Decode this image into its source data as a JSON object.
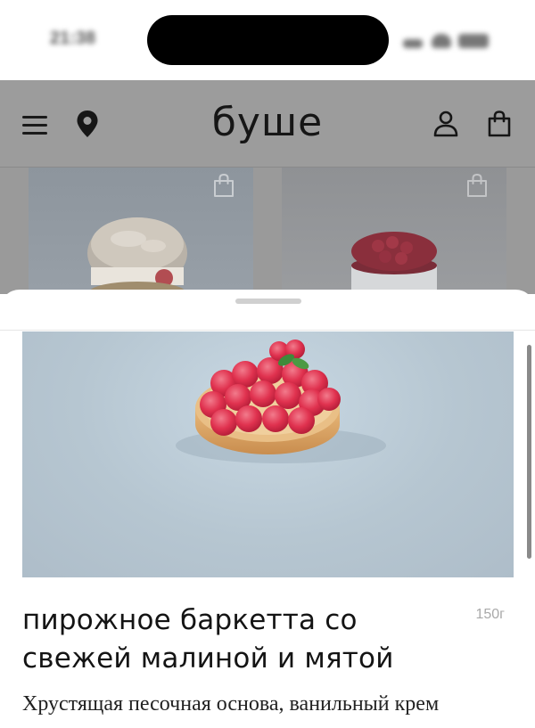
{
  "status_bar": {
    "time": "21:38"
  },
  "header": {
    "brand": "буше"
  },
  "sheet": {
    "product": {
      "title": "пирожное баркетта со свежей малиной и мятой",
      "weight": "150г",
      "description": "Хрустящая песочная основа, ванильный крем"
    }
  },
  "icons": {
    "menu": "hamburger-menu-icon",
    "location": "map-pin-icon",
    "account": "user-icon",
    "cart": "shopping-bag-icon"
  },
  "colors": {
    "overlay": "#9a9a9a",
    "sheet_background": "#ffffff",
    "title_text": "#141414",
    "weight_text": "#a9a9a9"
  }
}
